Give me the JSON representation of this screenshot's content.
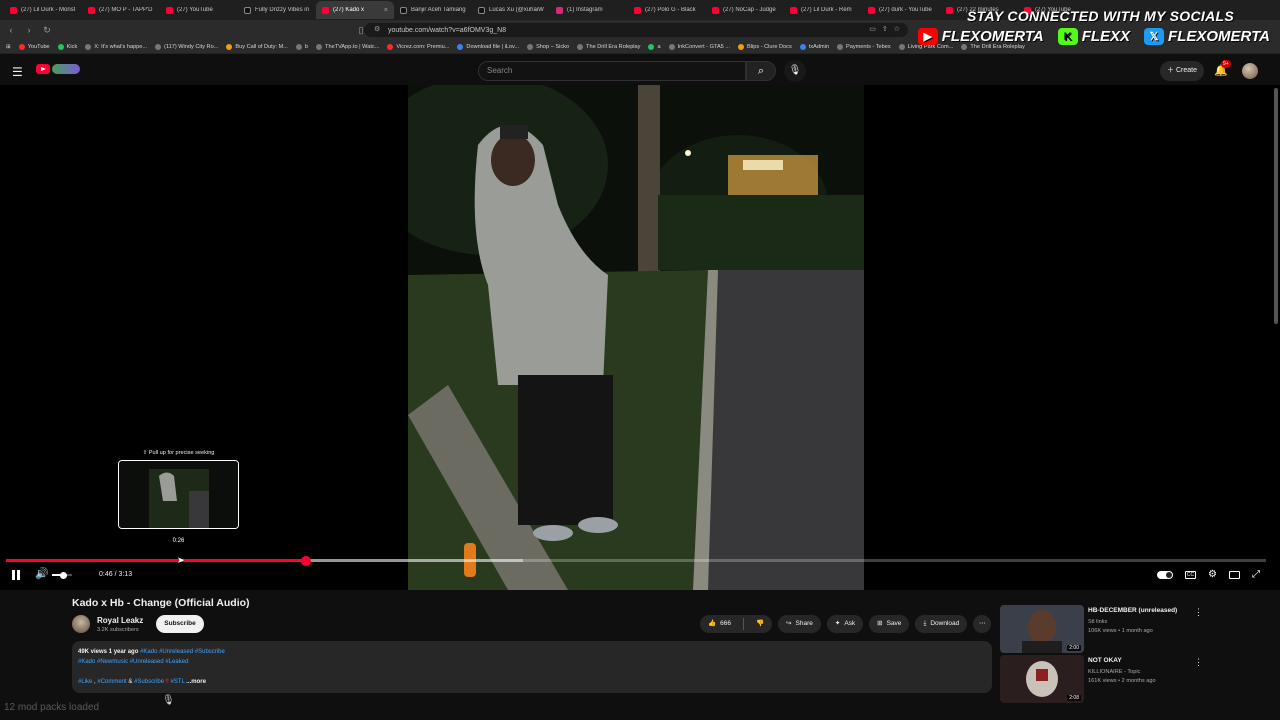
{
  "browser": {
    "tabs": [
      {
        "label": "(27) Lil Durk - Monst",
        "icon": "youtube-icon",
        "active": false
      },
      {
        "label": "(27) MO P - TAPP'D",
        "icon": "youtube-icon",
        "active": false
      },
      {
        "label": "(27) YouTube",
        "icon": "youtube-icon",
        "active": false
      },
      {
        "label": "Fully Drizzy Vibes in",
        "icon": "tiktok-icon",
        "active": false
      },
      {
        "label": "(27) Kado x",
        "icon": "youtube-icon",
        "active": true
      },
      {
        "label": "Banjir Aceh Tamiang",
        "icon": "tiktok-icon",
        "active": false
      },
      {
        "label": "Lucas Xu (@xuhaiW",
        "icon": "tiktok-icon",
        "active": false
      },
      {
        "label": "(1) Instagram",
        "icon": "instagram-icon",
        "active": false
      },
      {
        "label": "(27) Polo G - Black",
        "icon": "youtube-icon",
        "active": false
      },
      {
        "label": "(27) NoCap - Judge",
        "icon": "youtube-icon",
        "active": false
      },
      {
        "label": "(27) Lil Durk - Rem",
        "icon": "youtube-icon",
        "active": false
      },
      {
        "label": "(27) durk - YouTube",
        "icon": "youtube-icon",
        "active": false
      },
      {
        "label": "(27) 22 minutes",
        "icon": "youtube-icon",
        "active": false
      },
      {
        "label": "(27) YouTube",
        "icon": "youtube-icon",
        "active": false
      }
    ],
    "url": "youtube.com/watch?v=a6fOMV3g_N8",
    "bookmarks": [
      {
        "label": "YouTube",
        "color": "red"
      },
      {
        "label": "Kick",
        "color": "grn"
      },
      {
        "label": "X: It's what's happe...",
        "color": ""
      },
      {
        "label": "(117) Windy City Ro...",
        "color": ""
      },
      {
        "label": "Buy Call of Duty: M...",
        "color": "org"
      },
      {
        "label": "b",
        "color": ""
      },
      {
        "label": "TheTVApp.to | Watc...",
        "color": ""
      },
      {
        "label": "Vicrez.com: Premiu...",
        "color": "red"
      },
      {
        "label": "Download file | iLov...",
        "color": "blu"
      },
      {
        "label": "Shop – Sicko",
        "color": ""
      },
      {
        "label": "The Drill Era Roleplay",
        "color": ""
      },
      {
        "label": "a",
        "color": "grn"
      },
      {
        "label": "InkConvert - GTA5 ...",
        "color": ""
      },
      {
        "label": "Blips - Clure Docs",
        "color": "org"
      },
      {
        "label": "txAdmin",
        "color": "blu"
      },
      {
        "label": "Payments - Tebex",
        "color": ""
      },
      {
        "label": "Living Park Com...",
        "color": ""
      },
      {
        "label": "The Drill Era Roleplay",
        "color": ""
      }
    ]
  },
  "overlay": {
    "title": "STAY CONNECTED WITH MY SOCIALS",
    "socials": [
      {
        "platform": "youtube-icon",
        "handle": "FLEXOMERTA"
      },
      {
        "platform": "kick-icon",
        "handle": "FLEXX"
      },
      {
        "platform": "x-icon",
        "handle": "FLEXOMERTA"
      }
    ],
    "bottom_text": "12 mod packs loaded"
  },
  "masthead": {
    "search_placeholder": "Search",
    "create_label": "Create",
    "notification_count": "9+"
  },
  "player": {
    "seek_hint": "⇧ Pull up for precise seeking",
    "preview_time": "0:26",
    "current_time": "0:46",
    "duration": "3:13",
    "time_display": "0:46 / 3:13",
    "played_fraction": 0.238,
    "hover_fraction": 0.135,
    "buffered_fraction": 0.41,
    "volume_fraction": 0.55,
    "colors": {
      "progress": "#ff0033"
    }
  },
  "video": {
    "title": "Kado x Hb - Change (Official Audio)",
    "channel_name": "Royal Leakz",
    "subscribers": "3.2K subscribers",
    "subscribe_label": "Subscribe",
    "likes": "666",
    "share_label": "Share",
    "ask_label": "Ask",
    "save_label": "Save",
    "download_label": "Download",
    "views": "49K views",
    "age": "1 year ago",
    "desc_tags_line1": "#Kado #Unreleased #Subscribe",
    "desc_tags_line2": "#Kado #Newmusic #Unreleased #Leaked",
    "desc_tags_line3a": "#Like",
    "desc_tags_line3b": "#Comment",
    "desc_tags_line3c": "#Subscribe",
    "desc_tags_line3d": "#STL",
    "desc_sep1": ",",
    "desc_sep2": "&",
    "desc_bang": "‼",
    "more_label": "...more"
  },
  "related": [
    {
      "title": "HB-DECEMBER (unreleased)",
      "channel": "Stl links",
      "meta": "106K views • 1 month ago",
      "duration": "2:00"
    },
    {
      "title": "NOT OKAY",
      "channel": "KILLIONAIRE - Topic",
      "meta": "161K views • 2 months ago",
      "duration": "2:08"
    }
  ]
}
